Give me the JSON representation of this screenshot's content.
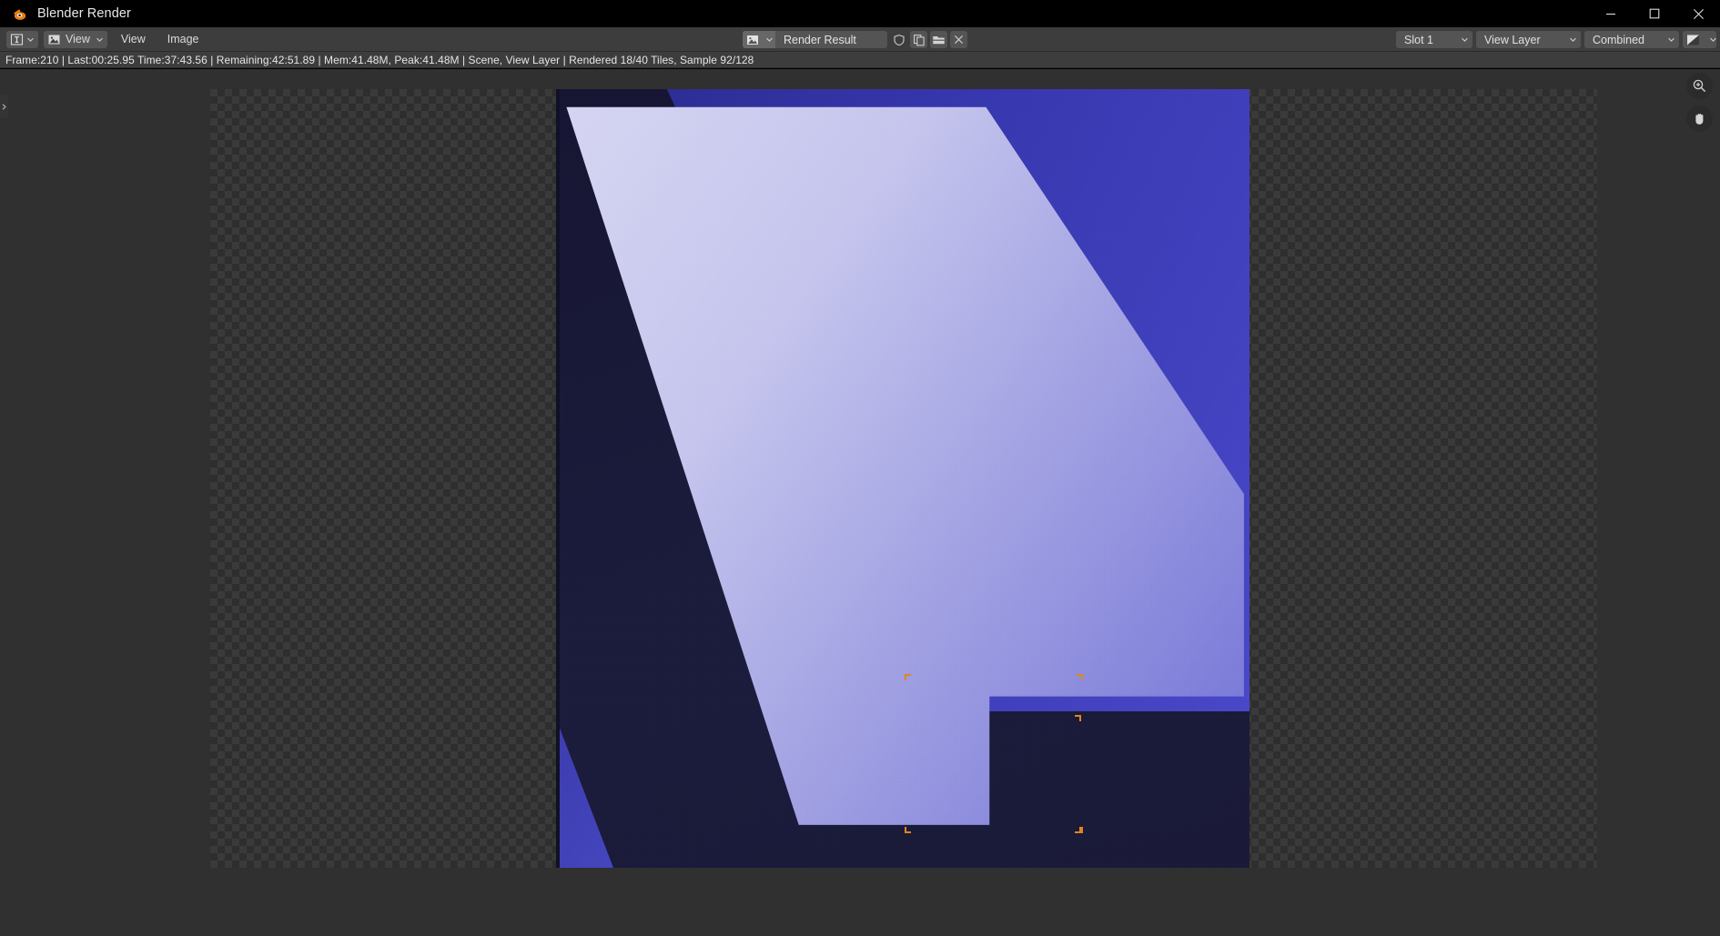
{
  "window": {
    "title": "Blender Render",
    "logo_icon": "blender-logo-icon",
    "controls": [
      {
        "name": "minimize",
        "icon": "minimize-icon"
      },
      {
        "name": "maximize",
        "icon": "maximize-icon"
      },
      {
        "name": "close",
        "icon": "close-icon"
      }
    ]
  },
  "header": {
    "editor_type": {
      "icon": "image-editor-icon",
      "chevron": "chevron-down-icon"
    },
    "mode": {
      "icon": "view-mode-icon",
      "label": "View",
      "chevron": "chevron-down-icon"
    },
    "menus": [
      {
        "label": "View"
      },
      {
        "label": "Image"
      }
    ],
    "image_datablock": {
      "icon": "image-datablock-icon",
      "chevron": "chevron-down-icon",
      "name": "Render Result",
      "buttons": [
        {
          "name": "fake-user-button",
          "icon": "shield-icon"
        },
        {
          "name": "new-image-button",
          "icon": "copy-icon"
        },
        {
          "name": "open-image-button",
          "icon": "folder-icon"
        },
        {
          "name": "unlink-button",
          "icon": "close-x-icon"
        }
      ]
    },
    "right_controls": {
      "slot": {
        "label": "Slot 1",
        "chevron": "chevron-down-icon"
      },
      "layer": {
        "label": "View Layer",
        "chevron": "chevron-down-icon"
      },
      "pass": {
        "label": "Combined",
        "chevron": "chevron-down-icon"
      },
      "display_channels": {
        "icon": "image-display-icon",
        "chevron": "chevron-down-icon"
      }
    }
  },
  "status": {
    "text": "Frame:210 | Last:00:25.95 Time:37:43.56 | Remaining:42:51.89 | Mem:41.48M, Peak:41.48M | Scene, View Layer | Rendered 18/40 Tiles, Sample 92/128",
    "frame": "210",
    "last": "00:25.95",
    "time": "37:43.56",
    "remaining": "42:51.89",
    "mem": "41.48M",
    "peak": "41.48M",
    "scene": "Scene",
    "view_layer": "View Layer",
    "tiles": "18/40",
    "sample": "92/128"
  },
  "viewport": {
    "tools": [
      {
        "name": "zoom-tool",
        "icon": "magnifier-plus-icon"
      },
      {
        "name": "pan-tool",
        "icon": "hand-icon"
      }
    ],
    "sidebar_tab": {
      "name": "sidebar-toggle",
      "icon": "chevron-right-icon"
    },
    "render_image": {
      "name": "render-result-image"
    },
    "active_tiles": 2
  },
  "colors": {
    "title_bar": "#000000",
    "header_bg": "#3d3d3d",
    "widget_bg": "#545454",
    "text": "#e4e4e4",
    "viewport_bg": "#303030",
    "tile_marker": "#e0851e",
    "render_pale": "#d6d6f2",
    "render_blue": "#4848c8",
    "render_dark": "#161633"
  }
}
